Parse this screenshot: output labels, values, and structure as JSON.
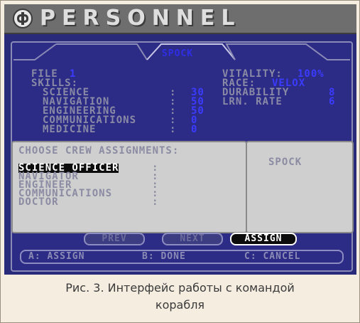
{
  "app": {
    "title": "PERSONNEL"
  },
  "tab": {
    "name": "SPOCK"
  },
  "crew": {
    "file_label": "FILE",
    "file_value": "1",
    "skills_label": "SKILLS:",
    "skills": [
      {
        "name": "SCIENCE",
        "value": "30"
      },
      {
        "name": "NAVIGATION",
        "value": "50"
      },
      {
        "name": "ENGINEERING",
        "value": "50"
      },
      {
        "name": "COMMUNICATIONS",
        "value": "0"
      },
      {
        "name": "MEDICINE",
        "value": "0"
      }
    ],
    "vitality_label": "VITALITY:",
    "vitality_value": "100%",
    "race_label": "RACE:",
    "race_value": "VELOX",
    "durability_label": "DURABILITY",
    "durability_value": "8",
    "lrn_label": "LRN. RATE",
    "lrn_value": "6"
  },
  "assignments": {
    "header": "CHOOSE CREW ASSIGNMENTS:",
    "items": [
      {
        "label": "SCIENCE OFFICER"
      },
      {
        "label": "NAVIGATOR"
      },
      {
        "label": "ENGINEER"
      },
      {
        "label": "COMMUNICATIONS"
      },
      {
        "label": "DOCTOR"
      }
    ],
    "selected_name": "SPOCK"
  },
  "buttons": {
    "prev": "PREV",
    "next": "NEXT",
    "assign": "ASSIGN"
  },
  "commands": {
    "a": "A: ASSIGN",
    "b": "B: DONE",
    "c": "C: CANCEL"
  },
  "caption": {
    "line1": "Рис. 3. Интерфейс работы с командой",
    "line2": "корабля"
  },
  "colors": {
    "screen_bg": "#2a2a7a",
    "value_blue": "#3b3bff",
    "label_grey": "#8a8aa6",
    "selected_highlight": "#0c0c0c"
  }
}
